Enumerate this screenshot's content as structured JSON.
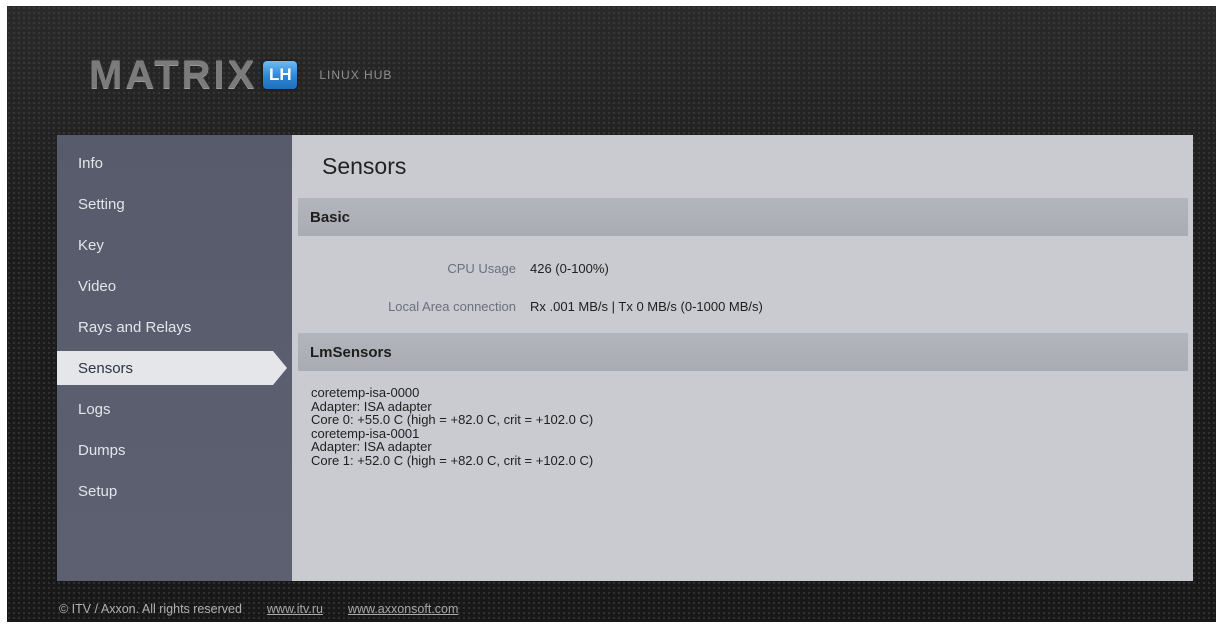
{
  "header": {
    "logo_word": "MATRIX",
    "logo_badge": "LH",
    "logo_subtitle": "LINUX HUB"
  },
  "sidebar": {
    "items": [
      {
        "label": "Info"
      },
      {
        "label": "Setting"
      },
      {
        "label": "Key"
      },
      {
        "label": "Video"
      },
      {
        "label": "Rays and Relays"
      },
      {
        "label": "Sensors",
        "active": true
      },
      {
        "label": "Logs"
      },
      {
        "label": "Dumps"
      },
      {
        "label": "Setup"
      }
    ]
  },
  "main": {
    "title": "Sensors",
    "basic": {
      "header": "Basic",
      "rows": [
        {
          "label": "CPU Usage",
          "value": "426 (0-100%)"
        },
        {
          "label": "Local Area connection",
          "value": "Rx .001 MB/s | Tx 0 MB/s (0-1000 MB/s)"
        }
      ]
    },
    "lmsensors": {
      "header": "LmSensors",
      "lines": [
        "coretemp-isa-0000",
        "Adapter: ISA adapter",
        "Core 0: +55.0 C (high = +82.0 C, crit = +102.0 C)",
        "coretemp-isa-0001",
        "Adapter: ISA adapter",
        "Core 1: +52.0 C (high = +82.0 C, crit = +102.0 C)"
      ]
    }
  },
  "footer": {
    "copyright": "© ITV / Axxon. All rights reserved",
    "links": [
      "www.itv.ru",
      "www.axxonsoft.com"
    ]
  },
  "colors": {
    "accent_blue": "#2e86d6",
    "sidebar_bg": "#575b6b",
    "content_bg": "#c9cbd0",
    "section_header_bg": "#adb0b7"
  }
}
